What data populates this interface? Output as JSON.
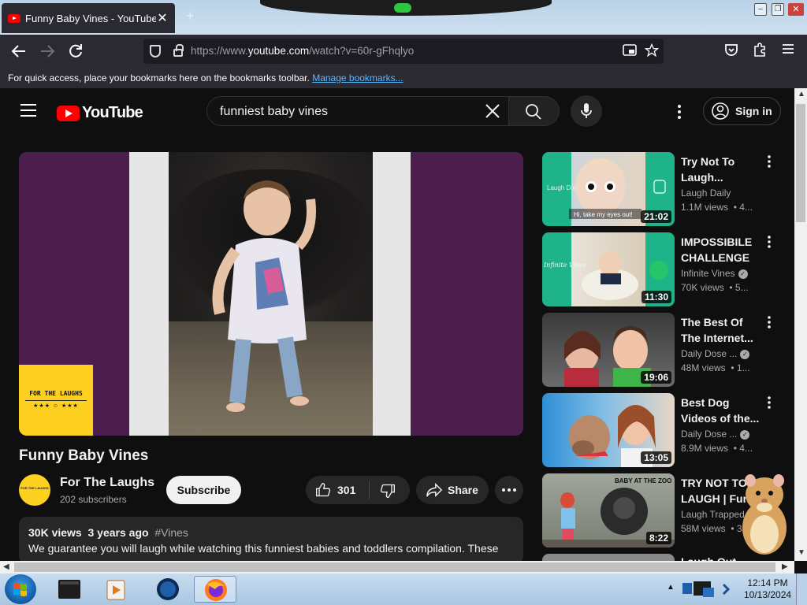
{
  "browser": {
    "tab_title": "Funny Baby Vines - YouTube",
    "tab_close": "✕",
    "new_tab": "+",
    "url_prefix": "https://www.",
    "url_host": "youtube.com",
    "url_path": "/watch?v=60r-gFhqlyo",
    "bookmarks_msg": "For quick access, place your bookmarks here on the bookmarks toolbar.",
    "bookmarks_link": "Manage bookmarks..."
  },
  "masthead": {
    "logo": "YouTube",
    "search_value": "funniest baby vines",
    "signin": "Sign in"
  },
  "video": {
    "title": "Funny Baby Vines",
    "overlay_brand": "FOR THE LAUGHS",
    "overlay_stars": "★★★ ☺ ★★★",
    "channel_avatar_text": "FOR THE LAUGHS",
    "channel": "For The Laughs",
    "subscribers": "202 subscribers",
    "subscribe": "Subscribe",
    "likes": "301",
    "share": "Share",
    "views": "30K views",
    "age": "3 years ago",
    "hashtag": "#Vines",
    "description": "We guarantee you will laugh while watching this funniest babies and toddlers compilation. These"
  },
  "recommendations": [
    {
      "title": "Try Not To Laugh...",
      "channel": "Laugh Daily",
      "verified": false,
      "views": "1.1M views",
      "age": "• 4...",
      "duration": "21:02",
      "thumb_text": "Hi, take my eyes out!",
      "thumb_side_text": "Laugh Daily"
    },
    {
      "title": "IMPOSSIBILE CHALLENGE :...",
      "channel": "Infinite Vines",
      "verified": true,
      "views": "70K views",
      "age": "• 5...",
      "duration": "11:30",
      "thumb_side_text": "Infinite Vines"
    },
    {
      "title": "The Best Of The Internet...",
      "channel": "Daily Dose ...",
      "verified": true,
      "views": "48M views",
      "age": "• 1...",
      "duration": "19:06"
    },
    {
      "title": "Best Dog Videos of the...",
      "channel": "Daily Dose ...",
      "verified": true,
      "views": "8.9M views",
      "age": "• 4...",
      "duration": "13:05"
    },
    {
      "title": "TRY NOT TO LAUGH | Fun...",
      "channel": "Laugh Trapped",
      "verified": false,
      "views": "58M views",
      "age": "• 3...",
      "duration": "8:22",
      "thumb_text": "BABY AT THE ZOO"
    }
  ],
  "partial_next_title": "Laugh Out...",
  "taskbar": {
    "time": "12:14 PM",
    "date": "10/13/2024"
  },
  "colors": {
    "yt_bg": "#0f0f0f",
    "yt_red": "#ff0000",
    "browser_bar": "#2b2a33",
    "link_blue": "#58b8ff",
    "player_purple": "#4c1e4e",
    "brand_yellow": "#fdd020"
  }
}
